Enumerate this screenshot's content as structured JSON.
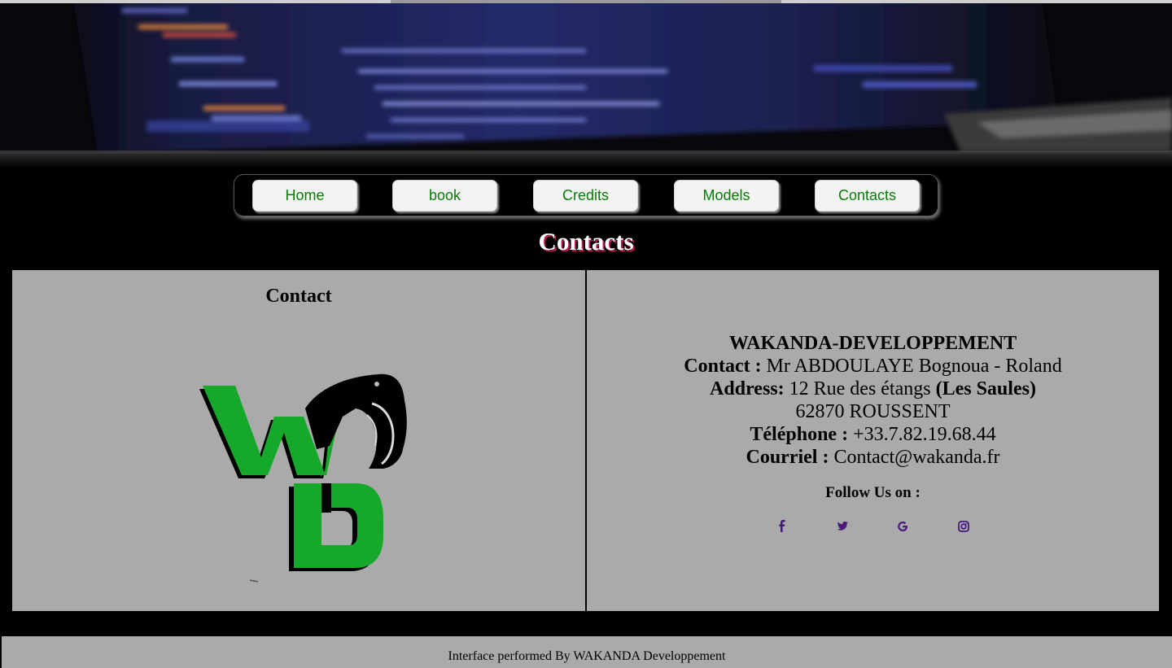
{
  "nav": {
    "items": [
      {
        "label": "Home"
      },
      {
        "label": "book"
      },
      {
        "label": "Credits"
      },
      {
        "label": "Models"
      },
      {
        "label": "Contacts"
      }
    ]
  },
  "page": {
    "title": "Contacts"
  },
  "left_panel": {
    "title": "Contact"
  },
  "contact": {
    "company": "WAKANDA-DEVELOPPEMENT",
    "contact_label": "Contact :",
    "contact_value": "Mr ABDOULAYE Bognoua - Roland",
    "address_label": "Address:",
    "address_value": "12 Rue des étangs",
    "address_extra": "(Les Saules)",
    "city": "62870 ROUSSENT",
    "phone_label": "Téléphone :",
    "phone_value": "+33.7.82.19.68.44",
    "email_label": "Courriel :",
    "email_value": "Contact@wakanda.fr"
  },
  "social": {
    "follow_label": "Follow Us on :",
    "icons": [
      "facebook-icon",
      "twitter-icon",
      "google-icon",
      "instagram-icon"
    ],
    "icon_color": "#4a1a7a"
  },
  "footer": {
    "text": "Interface performed By WAKANDA Developpement"
  },
  "colors": {
    "nav_text": "#0a7a0a",
    "panel_bg": "#aaaaaa",
    "logo_green": "#15a82a",
    "title_shadow": "#c2185b"
  }
}
